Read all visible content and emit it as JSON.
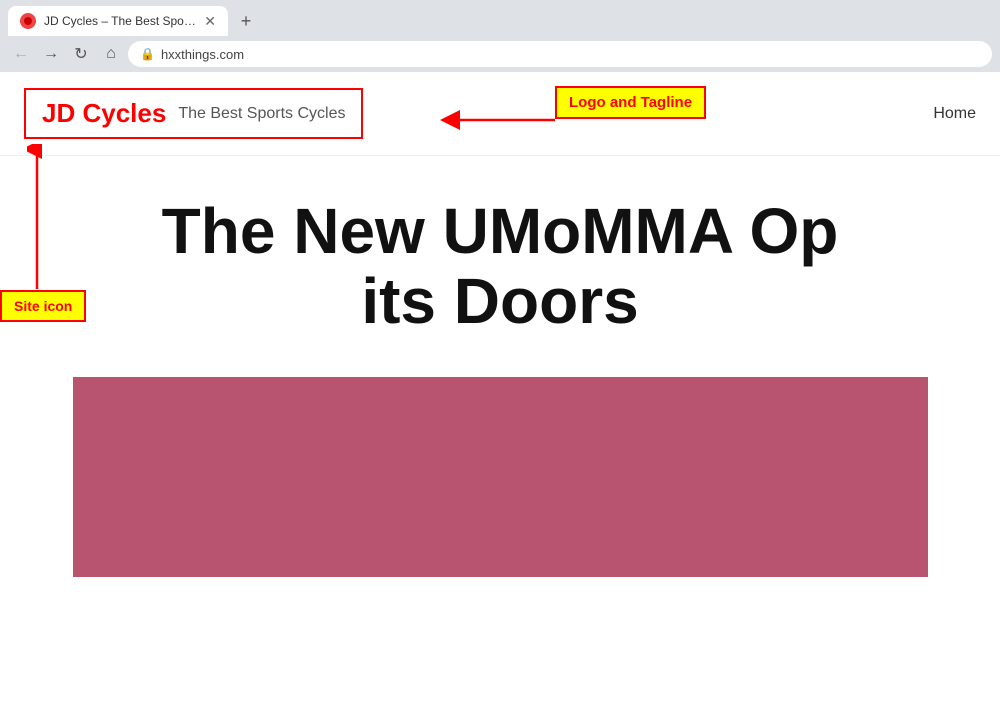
{
  "browser": {
    "tab_title": "JD Cycles – The Best Sports Cycle",
    "tab_new_label": "+",
    "url": "hxxthings.com",
    "nav": {
      "back": "←",
      "forward": "→",
      "reload": "↻",
      "home": "⌂"
    }
  },
  "annotations": {
    "logo_tagline_label": "Logo and Tagline",
    "site_icon_label": "Site icon"
  },
  "header": {
    "logo": "JD Cycles",
    "tagline": "The Best Sports Cycles",
    "nav_home": "Home"
  },
  "main": {
    "heading_line1": "The New UMoMMA Op",
    "heading_line2": "its Doors"
  }
}
